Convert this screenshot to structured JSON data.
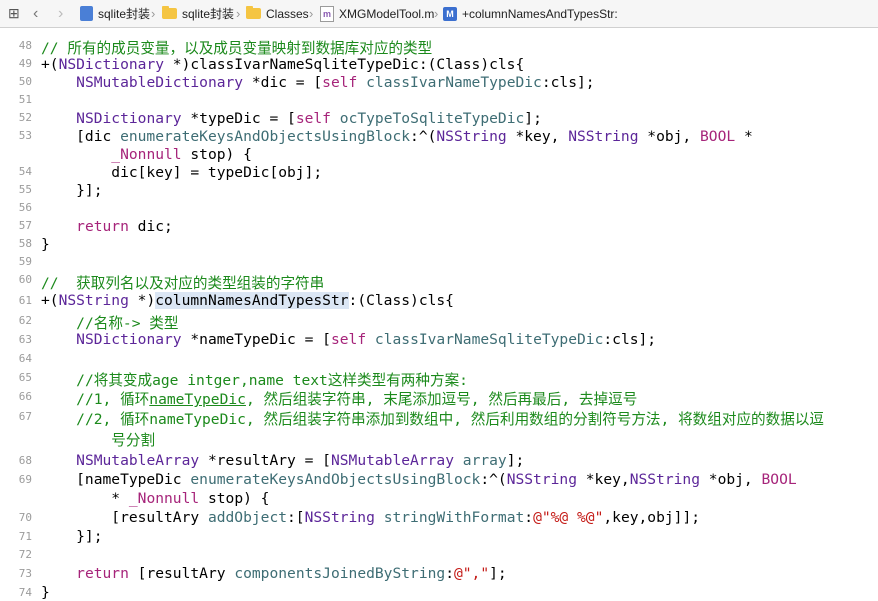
{
  "jumpbar": {
    "items": [
      {
        "label": "sqlite封装"
      },
      {
        "label": "sqlite封装"
      },
      {
        "label": "Classes"
      },
      {
        "label": "XMGModelTool.m",
        "badge": "m"
      },
      {
        "label": "+columnNamesAndTypesStr:",
        "badge": "M"
      }
    ]
  },
  "gutter": {
    "line_numbers": [
      "48",
      "49",
      "50",
      "51",
      "52",
      "53",
      "54",
      "55",
      "56",
      "57",
      "58",
      "59",
      "60",
      "61",
      "62",
      "63",
      "64",
      "65",
      "66",
      "67",
      "68",
      "69",
      "70",
      "71",
      "72",
      "73",
      "74"
    ]
  },
  "editor": {
    "lines": [
      [
        {
          "c": "cm",
          "t": "// 所有的成员变量，以及成员变量映射到数据库对应的类型"
        }
      ],
      [
        {
          "t": "+("
        },
        {
          "c": "ty",
          "t": "NSDictionary"
        },
        {
          "t": " *)classIvarNameSqliteTypeDic:(Class)cls{"
        }
      ],
      [
        {
          "t": "    "
        },
        {
          "c": "ty",
          "t": "NSMutableDictionary"
        },
        {
          "t": " *dic = ["
        },
        {
          "c": "kw",
          "t": "self"
        },
        {
          "t": " "
        },
        {
          "c": "me",
          "t": "classIvarNameTypeDic"
        },
        {
          "t": ":cls];"
        }
      ],
      [],
      [
        {
          "t": "    "
        },
        {
          "c": "ty",
          "t": "NSDictionary"
        },
        {
          "t": " *typeDic = ["
        },
        {
          "c": "kw",
          "t": "self"
        },
        {
          "t": " "
        },
        {
          "c": "me",
          "t": "ocTypeToSqliteTypeDic"
        },
        {
          "t": "];"
        }
      ],
      [
        {
          "t": "    [dic "
        },
        {
          "c": "me",
          "t": "enumerateKeysAndObjectsUsingBlock"
        },
        {
          "t": ":^("
        },
        {
          "c": "ty",
          "t": "NSString"
        },
        {
          "t": " *key, "
        },
        {
          "c": "ty",
          "t": "NSString"
        },
        {
          "t": " *obj, "
        },
        {
          "c": "kw",
          "t": "BOOL"
        },
        {
          "t": " *"
        }
      ],
      [
        {
          "t": "        "
        },
        {
          "c": "kw",
          "t": "_Nonnull"
        },
        {
          "t": " stop) {"
        }
      ],
      [
        {
          "t": "        dic[key] = typeDic[obj];"
        }
      ],
      [
        {
          "t": "    }];"
        }
      ],
      [],
      [
        {
          "t": "    "
        },
        {
          "c": "kw",
          "t": "return"
        },
        {
          "t": " dic;"
        }
      ],
      [
        {
          "t": "}"
        }
      ],
      [],
      [
        {
          "c": "cm",
          "t": "//  获取列名以及对应的类型组装的字符串"
        }
      ],
      [
        {
          "t": "+("
        },
        {
          "c": "ty",
          "t": "NSString"
        },
        {
          "t": " *)"
        },
        {
          "c": "hl",
          "t": "columnNamesAndTypesStr"
        },
        {
          "t": ":(Class)cls{"
        }
      ],
      [
        {
          "t": "    "
        },
        {
          "c": "cm",
          "t": "//名称-> 类型"
        }
      ],
      [
        {
          "t": "    "
        },
        {
          "c": "ty",
          "t": "NSDictionary"
        },
        {
          "t": " *nameTypeDic = ["
        },
        {
          "c": "kw",
          "t": "self"
        },
        {
          "t": " "
        },
        {
          "c": "me",
          "t": "classIvarNameSqliteTypeDic"
        },
        {
          "t": ":cls];"
        }
      ],
      [],
      [
        {
          "t": "    "
        },
        {
          "c": "cm",
          "t": "//将其变成age intger,name text这样类型有两种方案:"
        }
      ],
      [
        {
          "t": "    "
        },
        {
          "c": "cm",
          "t": "//1, 循环"
        },
        {
          "c": "lk",
          "t": "nameTypeDic"
        },
        {
          "c": "cm",
          "t": ", 然后组装字符串, 末尾添加逗号, 然后再最后, 去掉逗号"
        }
      ],
      [
        {
          "t": "    "
        },
        {
          "c": "cm",
          "t": "//2, 循环nameTypeDic, 然后组装字符串添加到数组中, 然后利用数组的分割符号方法, 将数组对应的数据以逗"
        }
      ],
      [
        {
          "t": "        "
        },
        {
          "c": "cm",
          "t": "号分割"
        }
      ],
      [
        {
          "t": "    "
        },
        {
          "c": "ty",
          "t": "NSMutableArray"
        },
        {
          "t": " *resultAry = ["
        },
        {
          "c": "ty",
          "t": "NSMutableArray"
        },
        {
          "t": " "
        },
        {
          "c": "me",
          "t": "array"
        },
        {
          "t": "];"
        }
      ],
      [
        {
          "t": "    [nameTypeDic "
        },
        {
          "c": "me",
          "t": "enumerateKeysAndObjectsUsingBlock"
        },
        {
          "t": ":^("
        },
        {
          "c": "ty",
          "t": "NSString"
        },
        {
          "t": " *key,"
        },
        {
          "c": "ty",
          "t": "NSString"
        },
        {
          "t": " *obj, "
        },
        {
          "c": "kw",
          "t": "BOOL"
        }
      ],
      [
        {
          "t": "        * "
        },
        {
          "c": "kw",
          "t": "_Nonnull"
        },
        {
          "t": " stop) {"
        }
      ],
      [
        {
          "t": "        [resultAry "
        },
        {
          "c": "me",
          "t": "addObject"
        },
        {
          "t": ":["
        },
        {
          "c": "ty",
          "t": "NSString"
        },
        {
          "t": " "
        },
        {
          "c": "me",
          "t": "stringWithFormat"
        },
        {
          "t": ":"
        },
        {
          "c": "st",
          "t": "@\"%@ %@\""
        },
        {
          "t": ",key,obj]];"
        }
      ],
      [
        {
          "t": "    }];"
        }
      ],
      [],
      [
        {
          "t": "    "
        },
        {
          "c": "kw",
          "t": "return"
        },
        {
          "t": " [resultAry "
        },
        {
          "c": "me",
          "t": "componentsJoinedByString"
        },
        {
          "t": ":"
        },
        {
          "c": "st",
          "t": "@\",\""
        },
        {
          "t": "];"
        }
      ],
      [
        {
          "t": "}"
        }
      ]
    ]
  }
}
